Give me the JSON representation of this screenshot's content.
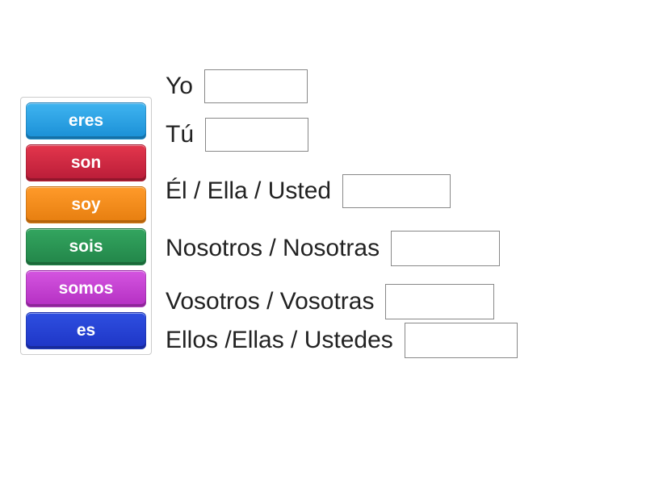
{
  "tiles": [
    {
      "label": "eres",
      "colorClass": "tile-blue"
    },
    {
      "label": "son",
      "colorClass": "tile-red"
    },
    {
      "label": "soy",
      "colorClass": "tile-orange"
    },
    {
      "label": "sois",
      "colorClass": "tile-green"
    },
    {
      "label": "somos",
      "colorClass": "tile-magenta"
    },
    {
      "label": "es",
      "colorClass": "tile-dblue"
    }
  ],
  "prompts": [
    {
      "label": "Yo"
    },
    {
      "label": "Tú"
    },
    {
      "label": "Él / Ella / Usted"
    },
    {
      "label": "Nosotros / Nosotras"
    },
    {
      "label": "Vosotros / Vosotras"
    },
    {
      "label": "Ellos /Ellas / Ustedes"
    }
  ]
}
